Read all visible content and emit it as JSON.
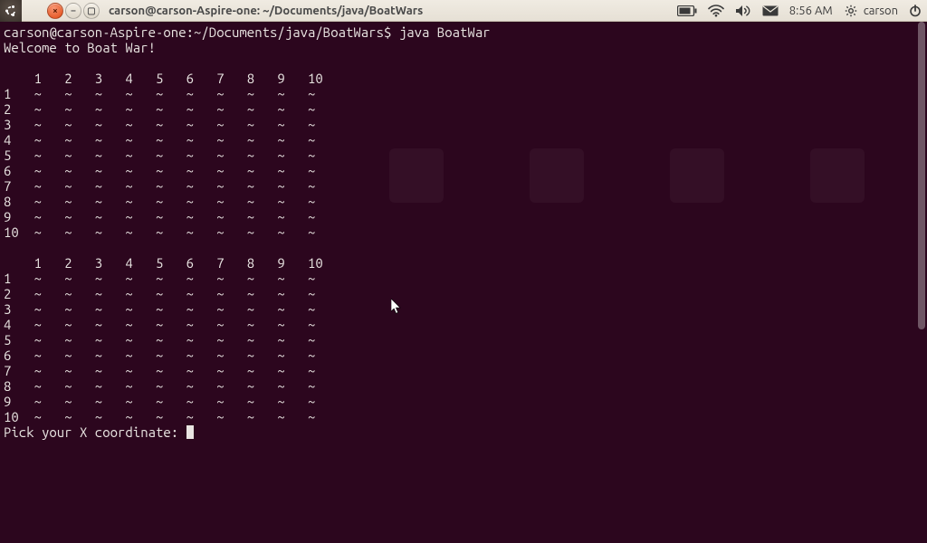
{
  "menubar": {
    "window_title": "carson@carson-Aspire-one: ~/Documents/java/BoatWars",
    "clock": "8:56 AM",
    "username": "carson"
  },
  "terminal": {
    "prompt": "carson@carson-Aspire-one:~/Documents/java/BoatWars$ ",
    "command": "java BoatWar",
    "welcome": "Welcome to Boat War!",
    "header": "    1   2   3   4   5   6   7   8   9   10",
    "rows": [
      "1   ~   ~   ~   ~   ~   ~   ~   ~   ~   ~",
      "2   ~   ~   ~   ~   ~   ~   ~   ~   ~   ~",
      "3   ~   ~   ~   ~   ~   ~   ~   ~   ~   ~",
      "4   ~   ~   ~   ~   ~   ~   ~   ~   ~   ~",
      "5   ~   ~   ~   ~   ~   ~   ~   ~   ~   ~",
      "6   ~   ~   ~   ~   ~   ~   ~   ~   ~   ~",
      "7   ~   ~   ~   ~   ~   ~   ~   ~   ~   ~",
      "8   ~   ~   ~   ~   ~   ~   ~   ~   ~   ~",
      "9   ~   ~   ~   ~   ~   ~   ~   ~   ~   ~",
      "10  ~   ~   ~   ~   ~   ~   ~   ~   ~   ~"
    ],
    "prompt2": "Pick your X coordinate: "
  }
}
